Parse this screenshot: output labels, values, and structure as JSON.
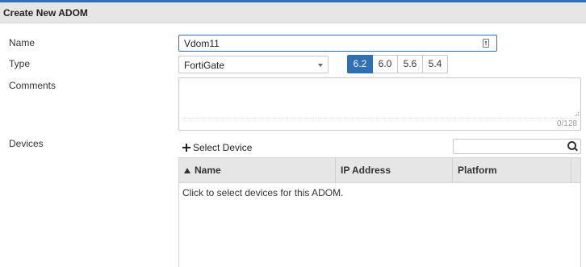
{
  "dialog": {
    "title": "Create New ADOM"
  },
  "form": {
    "name_label": "Name",
    "name_value": "Vdom11",
    "type_label": "Type",
    "type_value": "FortiGate",
    "versions": [
      {
        "label": "6.2",
        "active": true
      },
      {
        "label": "6.0",
        "active": false
      },
      {
        "label": "5.6",
        "active": false
      },
      {
        "label": "5.4",
        "active": false
      }
    ],
    "comments_label": "Comments",
    "comments_counter": "0/128",
    "devices_label": "Devices"
  },
  "devices": {
    "select_button_label": "Select Device",
    "search_placeholder": "",
    "columns": [
      "Name",
      "IP Address",
      "Platform"
    ],
    "sorted_column": "Name",
    "empty_message": "Click to select devices for this ADOM."
  },
  "colors": {
    "accent": "#2f6fb3",
    "header_bg": "#e6e6e6",
    "border": "#c8c8c8"
  },
  "icons": {
    "plus": "plus-icon",
    "search": "search-icon",
    "keyboard": "keyboard-icon",
    "sort": "sort-ascending-icon",
    "dropdown": "chevron-down-icon"
  }
}
